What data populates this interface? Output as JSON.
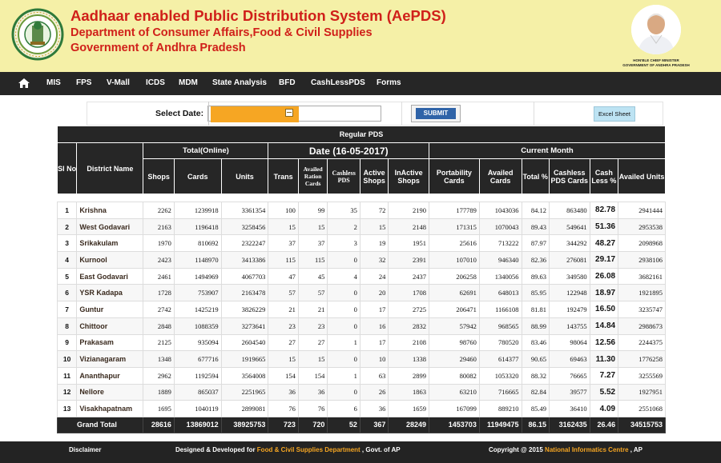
{
  "header": {
    "title": "Aadhaar enabled Public Distribution System (AePDS)",
    "subtitle1": "Department of Consumer Affairs,Food & Civil Supplies",
    "subtitle2": "Government of Andhra Pradesh",
    "cm_caption1": "HON'BLE CHIEF MINISTER",
    "cm_caption2": "GOVERNMENT OF ANDHRA PRADESH"
  },
  "nav": [
    "MIS",
    "FPS",
    "V-Mall",
    "ICDS",
    "MDM",
    "State Analysis",
    "BFD",
    "CashLessPDS",
    "Forms"
  ],
  "controls": {
    "select_date_label": "Select Date:",
    "submit_label": "SUBMIT",
    "excel_label": "Excel Sheet"
  },
  "table": {
    "caption": "Regular   PDS",
    "group_total": "Total(Online)",
    "group_date": "Date  (16-05-2017)",
    "group_month": "Current Month",
    "h_sl": "Sl No",
    "h_district": "District Name",
    "h_shops": "Shops",
    "h_cards": "Cards",
    "h_units": "Units",
    "h_trans": "Trans",
    "h_availed_ration": "Availed Ration Cards",
    "h_cashless_pds": "Cashless PDS",
    "h_active": "Active Shops",
    "h_inactive": "InActive Shops",
    "h_portability": "Portability Cards",
    "h_availed_cards": "Availed Cards",
    "h_total_pct": "Total %",
    "h_cashless_pds_cards": "Cashless PDS Cards",
    "h_cashless_pct": "Cash Less %",
    "h_availed_units": "Availed Units",
    "rows": [
      [
        "1",
        "Krishna",
        "2262",
        "1239918",
        "3361354",
        "100",
        "99",
        "35",
        "72",
        "2190",
        "177789",
        "1043036",
        "84.12",
        "863480",
        "82.78",
        "2941444"
      ],
      [
        "2",
        "West Godavari",
        "2163",
        "1196418",
        "3258456",
        "15",
        "15",
        "2",
        "15",
        "2148",
        "171315",
        "1070043",
        "89.43",
        "549641",
        "51.36",
        "2953538"
      ],
      [
        "3",
        "Srikakulam",
        "1970",
        "810692",
        "2322247",
        "37",
        "37",
        "3",
        "19",
        "1951",
        "25616",
        "713222",
        "87.97",
        "344292",
        "48.27",
        "2098968"
      ],
      [
        "4",
        "Kurnool",
        "2423",
        "1148970",
        "3413386",
        "115",
        "115",
        "0",
        "32",
        "2391",
        "107010",
        "946340",
        "82.36",
        "276081",
        "29.17",
        "2938106"
      ],
      [
        "5",
        "East Godavari",
        "2461",
        "1494969",
        "4067703",
        "47",
        "45",
        "4",
        "24",
        "2437",
        "206258",
        "1340056",
        "89.63",
        "349580",
        "26.08",
        "3682161"
      ],
      [
        "6",
        "YSR Kadapa",
        "1728",
        "753907",
        "2163478",
        "57",
        "57",
        "0",
        "20",
        "1708",
        "62691",
        "648013",
        "85.95",
        "122948",
        "18.97",
        "1921895"
      ],
      [
        "7",
        "Guntur",
        "2742",
        "1425219",
        "3826229",
        "21",
        "21",
        "0",
        "17",
        "2725",
        "206471",
        "1166108",
        "81.81",
        "192479",
        "16.50",
        "3235747"
      ],
      [
        "8",
        "Chittoor",
        "2848",
        "1088359",
        "3273641",
        "23",
        "23",
        "0",
        "16",
        "2832",
        "57942",
        "968565",
        "88.99",
        "143755",
        "14.84",
        "2988673"
      ],
      [
        "9",
        "Prakasam",
        "2125",
        "935094",
        "2604540",
        "27",
        "27",
        "1",
        "17",
        "2108",
        "98760",
        "780520",
        "83.46",
        "98064",
        "12.56",
        "2244375"
      ],
      [
        "10",
        "Vizianagaram",
        "1348",
        "677716",
        "1919665",
        "15",
        "15",
        "0",
        "10",
        "1338",
        "29460",
        "614377",
        "90.65",
        "69463",
        "11.30",
        "1776258"
      ],
      [
        "11",
        "Ananthapur",
        "2962",
        "1192594",
        "3564008",
        "154",
        "154",
        "1",
        "63",
        "2899",
        "80082",
        "1053320",
        "88.32",
        "76665",
        "7.27",
        "3255569"
      ],
      [
        "12",
        "Nellore",
        "1889",
        "865037",
        "2251965",
        "36",
        "36",
        "0",
        "26",
        "1863",
        "63210",
        "716665",
        "82.84",
        "39577",
        "5.52",
        "1927951"
      ],
      [
        "13",
        "Visakhapatnam",
        "1695",
        "1040119",
        "2899081",
        "76",
        "76",
        "6",
        "36",
        "1659",
        "167099",
        "889210",
        "85.49",
        "36410",
        "4.09",
        "2551068"
      ]
    ],
    "total": [
      "Grand Total",
      "28616",
      "13869012",
      "38925753",
      "723",
      "720",
      "52",
      "367",
      "28249",
      "1453703",
      "11949475",
      "86.15",
      "3162435",
      "26.46",
      "34515753"
    ]
  },
  "footer": {
    "disclaimer": "Disclaimer",
    "designed_prefix": "Designed & Developed for ",
    "designed_dept": "Food & Civil Supplies Department",
    "designed_suffix": " ,  Govt. of AP",
    "copyright_prefix": "Copyright @ 2015 ",
    "copyright_org": "National Informatics Centre",
    "copyright_suffix": " , AP"
  }
}
